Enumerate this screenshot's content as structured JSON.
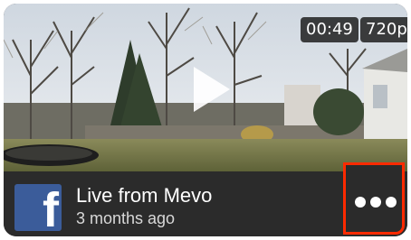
{
  "video": {
    "duration": "00:49",
    "quality": "720p",
    "title": "Live from Mevo",
    "age": "3 months ago",
    "source_icon": "facebook-icon",
    "more_icon": "more-options-icon",
    "highlight_color": "#ff2a00",
    "facebook_blue": "#3b5c9a"
  }
}
